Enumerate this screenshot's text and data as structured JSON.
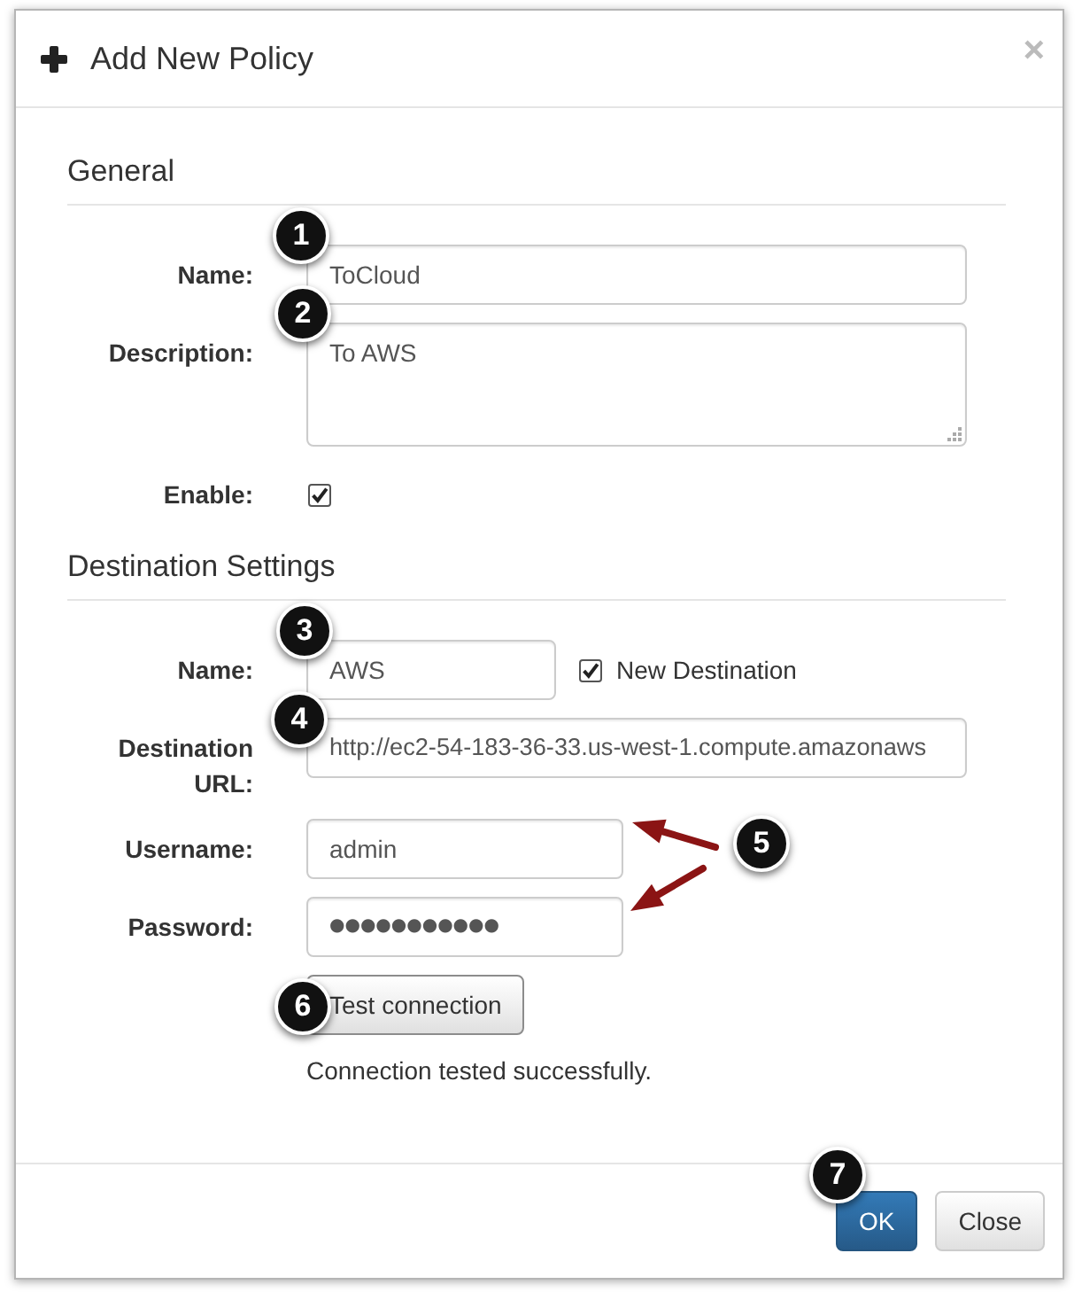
{
  "dialog": {
    "title": "Add New Policy",
    "close_label": "×"
  },
  "sections": [
    {
      "heading": "General",
      "fields": [
        {
          "kind": "text",
          "label": "Name:",
          "value": "ToCloud"
        },
        {
          "kind": "textarea",
          "label": "Description:",
          "value": "To AWS"
        },
        {
          "kind": "checkbox",
          "label": "Enable:",
          "checked": true
        }
      ]
    },
    {
      "heading": "Destination Settings",
      "fields": [
        {
          "kind": "text_with_option",
          "label": "Name:",
          "value": "AWS",
          "option": {
            "label": "New Destination",
            "checked": true
          }
        },
        {
          "kind": "text",
          "label": "Destination URL:",
          "value": "http://ec2-54-183-36-33.us-west-1.compute.amazonaws"
        },
        {
          "kind": "short_text",
          "label": "Username:",
          "value": "admin"
        },
        {
          "kind": "password",
          "label": "Password:",
          "value": "●●●●●●●●●●●"
        },
        {
          "kind": "button",
          "text": "Test connection"
        },
        {
          "kind": "message",
          "text": "Connection tested successfully."
        }
      ]
    }
  ],
  "footer": {
    "buttons": [
      {
        "kind": "primary",
        "label": "OK"
      },
      {
        "kind": "default",
        "label": "Close"
      }
    ]
  },
  "callouts": [
    {
      "number": "1"
    },
    {
      "number": "2"
    },
    {
      "number": "3"
    },
    {
      "number": "4"
    },
    {
      "number": "5"
    },
    {
      "number": "6"
    },
    {
      "number": "7"
    }
  ]
}
